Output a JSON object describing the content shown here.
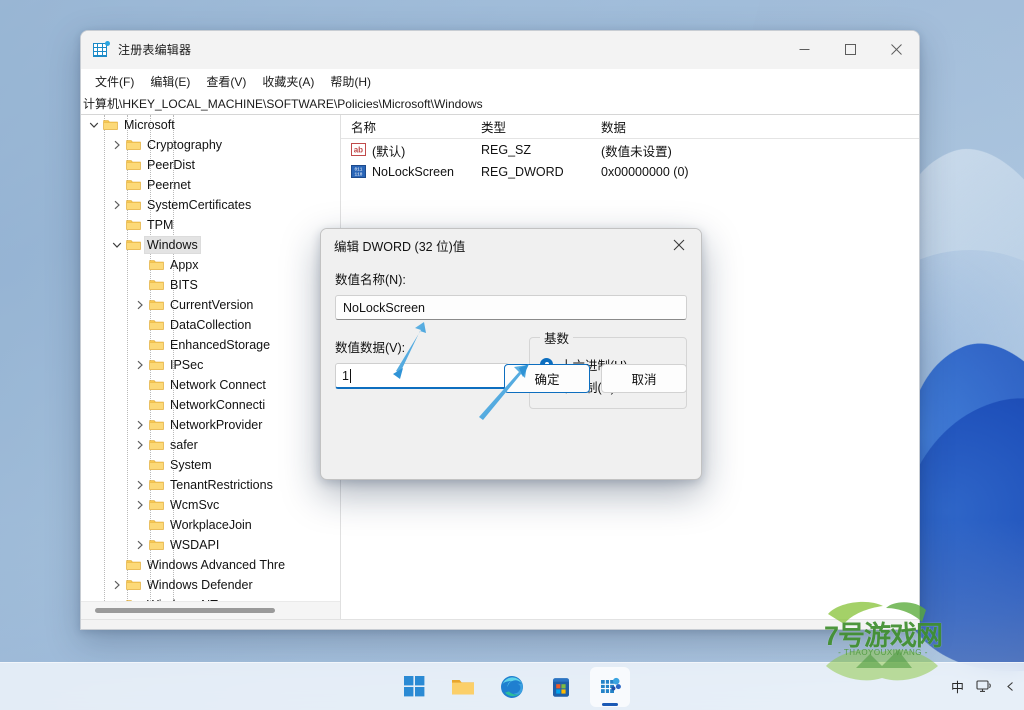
{
  "window": {
    "title": "注册表编辑器",
    "icon": "registry-icon",
    "controls": {
      "minimize": "—",
      "maximize": "□",
      "close": "✕"
    },
    "menu": [
      "文件(F)",
      "编辑(E)",
      "查看(V)",
      "收藏夹(A)",
      "帮助(H)"
    ],
    "address": "计算机\\HKEY_LOCAL_MACHINE\\SOFTWARE\\Policies\\Microsoft\\Windows"
  },
  "tree": {
    "items": [
      {
        "label": "Microsoft",
        "indent": 1,
        "twisty": "expanded",
        "selected": false
      },
      {
        "label": "Cryptography",
        "indent": 2,
        "twisty": "collapsed",
        "selected": false
      },
      {
        "label": "PeerDist",
        "indent": 2,
        "twisty": "none",
        "selected": false
      },
      {
        "label": "Peernet",
        "indent": 2,
        "twisty": "none",
        "selected": false
      },
      {
        "label": "SystemCertificates",
        "indent": 2,
        "twisty": "collapsed",
        "selected": false
      },
      {
        "label": "TPM",
        "indent": 2,
        "twisty": "none",
        "selected": false
      },
      {
        "label": "Windows",
        "indent": 2,
        "twisty": "expanded",
        "selected": true
      },
      {
        "label": "Appx",
        "indent": 3,
        "twisty": "none",
        "selected": false
      },
      {
        "label": "BITS",
        "indent": 3,
        "twisty": "none",
        "selected": false
      },
      {
        "label": "CurrentVersion",
        "indent": 3,
        "twisty": "collapsed",
        "selected": false
      },
      {
        "label": "DataCollection",
        "indent": 3,
        "twisty": "none",
        "selected": false
      },
      {
        "label": "EnhancedStorage",
        "indent": 3,
        "twisty": "none",
        "selected": false
      },
      {
        "label": "IPSec",
        "indent": 3,
        "twisty": "collapsed",
        "selected": false
      },
      {
        "label": "Network Connect",
        "indent": 3,
        "twisty": "none",
        "selected": false
      },
      {
        "label": "NetworkConnecti",
        "indent": 3,
        "twisty": "none",
        "selected": false
      },
      {
        "label": "NetworkProvider",
        "indent": 3,
        "twisty": "collapsed",
        "selected": false
      },
      {
        "label": "safer",
        "indent": 3,
        "twisty": "collapsed",
        "selected": false
      },
      {
        "label": "System",
        "indent": 3,
        "twisty": "none",
        "selected": false
      },
      {
        "label": "TenantRestrictions",
        "indent": 3,
        "twisty": "collapsed",
        "selected": false
      },
      {
        "label": "WcmSvc",
        "indent": 3,
        "twisty": "collapsed",
        "selected": false
      },
      {
        "label": "WorkplaceJoin",
        "indent": 3,
        "twisty": "none",
        "selected": false
      },
      {
        "label": "WSDAPI",
        "indent": 3,
        "twisty": "collapsed",
        "selected": false
      },
      {
        "label": "Windows Advanced Thre",
        "indent": 2,
        "twisty": "none",
        "selected": false
      },
      {
        "label": "Windows Defender",
        "indent": 2,
        "twisty": "collapsed",
        "selected": false
      },
      {
        "label": "Windows NT",
        "indent": 2,
        "twisty": "collapsed",
        "selected": false
      }
    ]
  },
  "list": {
    "columns": [
      "名称",
      "类型",
      "数据"
    ],
    "rows": [
      {
        "icon": "string-value-icon",
        "name": "(默认)",
        "type": "REG_SZ",
        "data": "(数值未设置)"
      },
      {
        "icon": "dword-value-icon",
        "name": "NoLockScreen",
        "type": "REG_DWORD",
        "data": "0x00000000 (0)"
      }
    ]
  },
  "dialog": {
    "title": "编辑 DWORD (32 位)值",
    "close_label": "✕",
    "value_name_label": "数值名称(N):",
    "value_name": "NoLockScreen",
    "value_data_label": "数值数据(V):",
    "value_data": "1",
    "base_group_label": "基数",
    "base_options": [
      {
        "label": "十六进制(H)",
        "selected": true
      },
      {
        "label": "十进制(D)",
        "selected": false
      }
    ],
    "ok_label": "确定",
    "cancel_label": "取消",
    "accent_color": "#0d6ebf"
  },
  "taskbar": {
    "items": [
      {
        "name": "start-button",
        "label": "开始",
        "active": false
      },
      {
        "name": "file-explorer",
        "label": "文件资源管理器",
        "active": false
      },
      {
        "name": "microsoft-edge",
        "label": "Microsoft Edge",
        "active": false
      },
      {
        "name": "microsoft-store",
        "label": "Microsoft Store",
        "active": false
      },
      {
        "name": "registry-editor",
        "label": "注册表编辑器",
        "active": true
      }
    ],
    "tray": {
      "ime": "中",
      "network": "network-icon",
      "more": "chevron-icon"
    }
  },
  "watermark": {
    "text": "7号游戏网",
    "subtitle": "- THAOYOUXIWANG -",
    "color": "#3f8f2e"
  }
}
